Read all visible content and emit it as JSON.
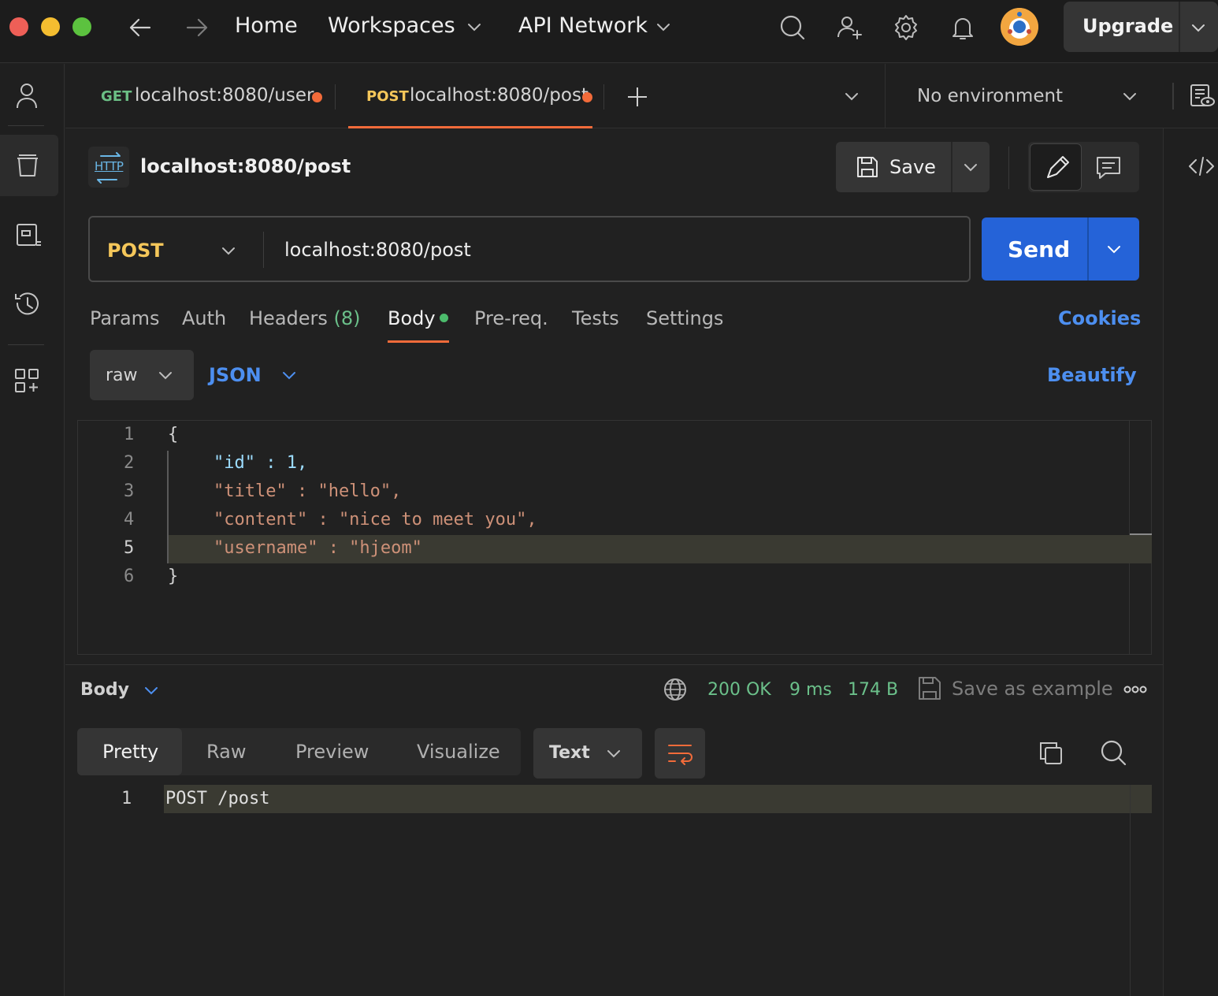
{
  "topbar": {
    "nav_home": "Home",
    "nav_workspaces": "Workspaces",
    "nav_api_network": "API Network",
    "upgrade_label": "Upgrade",
    "traffic_colors": [
      "#ee5f57",
      "#f4bd30",
      "#5cc23f"
    ]
  },
  "tabs": [
    {
      "method": "GET",
      "url": "localhost:8080/user",
      "method_color": "#6bbf85"
    },
    {
      "method": "POST",
      "url": "localhost:8080/post",
      "method_color": "#f5c75a"
    }
  ],
  "environment": {
    "selected": "No environment"
  },
  "request": {
    "protocol_badge": "HTTP",
    "title": "localhost:8080/post",
    "save_label": "Save",
    "method": "POST",
    "url": "localhost:8080/post",
    "send_label": "Send"
  },
  "request_tabs": {
    "params": "Params",
    "auth": "Auth",
    "headers": "Headers",
    "headers_count": "(8)",
    "body": "Body",
    "prereq": "Pre-req.",
    "tests": "Tests",
    "settings": "Settings",
    "cookies": "Cookies",
    "active": "Body"
  },
  "body_options": {
    "mode": "raw",
    "language": "JSON",
    "beautify": "Beautify"
  },
  "editor": {
    "active_line": 5,
    "lines": [
      {
        "num": "1",
        "text": "{"
      },
      {
        "num": "2",
        "text": "\"id\" : 1,"
      },
      {
        "num": "3",
        "text": "\"title\" : \"hello\","
      },
      {
        "num": "4",
        "text": "\"content\" : \"nice to meet you\","
      },
      {
        "num": "5",
        "text": "\"username\" : \"hjeom\""
      },
      {
        "num": "6",
        "text": "}"
      }
    ]
  },
  "response": {
    "body_label": "Body",
    "status": "200 OK",
    "time": "9 ms",
    "size": "174 B",
    "save_example": "Save as example",
    "view_tabs": [
      "Pretty",
      "Raw",
      "Preview",
      "Visualize"
    ],
    "active_view": "Pretty",
    "format": "Text",
    "lines": [
      {
        "num": "1",
        "text": "POST /post"
      }
    ]
  },
  "colors": {
    "accent_blue": "#2563d8",
    "link_blue": "#4d8ff0",
    "status_green": "#6bc08a",
    "active_underline": "#f26b3a",
    "json_key": "#9cdcfe",
    "json_string": "#ce9178",
    "json_number": "#b5cea8"
  }
}
